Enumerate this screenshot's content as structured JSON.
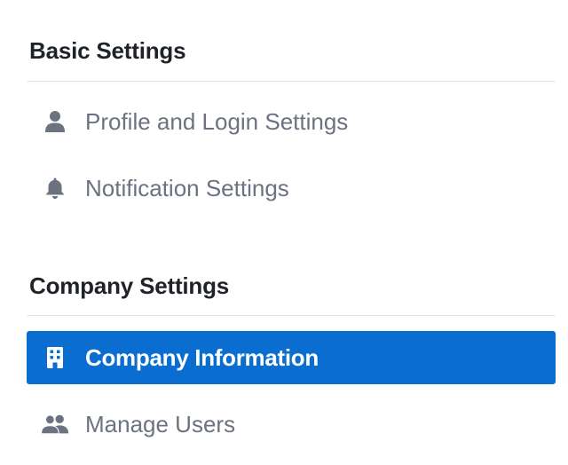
{
  "sections": [
    {
      "title": "Basic Settings",
      "items": [
        {
          "label": "Profile and Login Settings",
          "icon": "user-icon",
          "active": false
        },
        {
          "label": "Notification Settings",
          "icon": "bell-icon",
          "active": false
        }
      ]
    },
    {
      "title": "Company Settings",
      "items": [
        {
          "label": "Company Information",
          "icon": "building-icon",
          "active": true
        },
        {
          "label": "Manage Users",
          "icon": "users-icon",
          "active": false
        }
      ]
    }
  ],
  "colors": {
    "active_bg": "#0a6ed1",
    "active_text": "#ffffff",
    "inactive_text": "#6b7280",
    "icon_inactive": "#6b7280",
    "heading": "#1f2328",
    "divider": "#e3e6ea"
  }
}
